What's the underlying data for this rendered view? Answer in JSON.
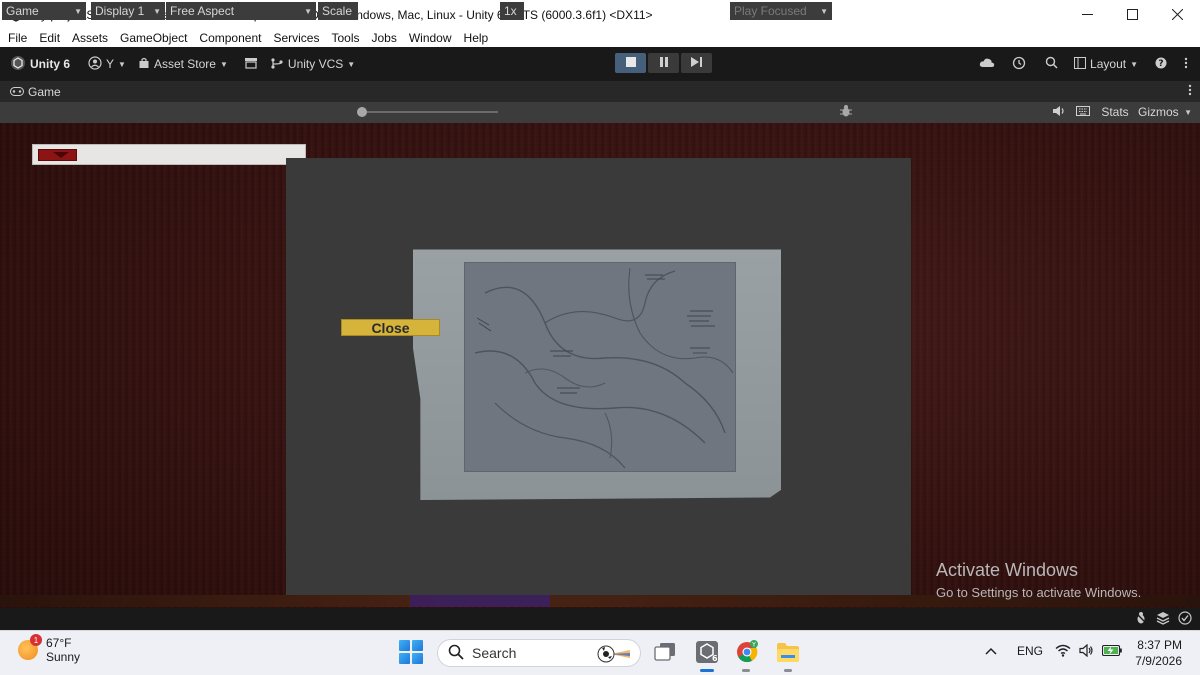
{
  "window": {
    "title": "My projectStore - UltimateSurvivalHorrorTpv1-YazanDev - Windows, Mac, Linux - Unity 6.3 LTS (6000.3.6f1) <DX11>"
  },
  "menu": [
    "File",
    "Edit",
    "Assets",
    "GameObject",
    "Component",
    "Services",
    "Tools",
    "Jobs",
    "Window",
    "Help"
  ],
  "toolbar": {
    "unity_label": "Unity 6",
    "account_label": "Y",
    "asset_store_label": "Asset Store",
    "vcs_label": "Unity VCS",
    "layout_label": "Layout"
  },
  "tab": {
    "label": "Game"
  },
  "game_bar": {
    "view_label": "Game",
    "display_label": "Display 1",
    "aspect_label": "Free Aspect",
    "scale_label": "Scale",
    "scale_value": "1x",
    "play_focused_label": "Play Focused",
    "stats_label": "Stats",
    "gizmos_label": "Gizmos"
  },
  "game_ui": {
    "close_label": "Close",
    "health_fraction": 0.15
  },
  "watermark": {
    "line1": "Activate Windows",
    "line2": "Go to Settings to activate Windows."
  },
  "taskbar": {
    "weather_temp": "67°F",
    "weather_desc": "Sunny",
    "weather_badge": "1",
    "search_label": "Search",
    "language": "ENG",
    "time": "8:37 PM",
    "date": "7/9/2026"
  },
  "colors": {
    "accent_play": "#46607c",
    "close_button": "#d6b43b",
    "health_fill": "#8d1414"
  }
}
